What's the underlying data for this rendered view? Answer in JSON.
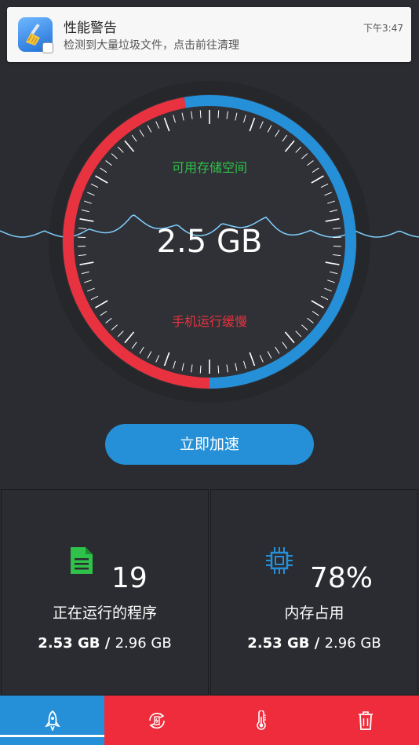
{
  "notification": {
    "title": "性能警告",
    "body": "检测到大量垃圾文件，点击前往清理",
    "time": "下午3:47",
    "icon": "broom-app-icon"
  },
  "gauge": {
    "label_top": "可用存储空间",
    "value": "2.5 GB",
    "label_bottom": "手机运行缓慢",
    "colors": {
      "red": "#e8323f",
      "blue": "#2590d8",
      "green": "#2fc24a"
    }
  },
  "boost_button": {
    "label": "立即加速"
  },
  "stats": {
    "left": {
      "icon": "document-icon",
      "count": "19",
      "label": "正在运行的程序",
      "mem_used": "2.53 GB",
      "mem_sep": " / ",
      "mem_total": "2.96 GB"
    },
    "right": {
      "icon": "cpu-chip-icon",
      "count": "78%",
      "label": "内存占用",
      "mem_used": "2.53 GB",
      "mem_sep": " / ",
      "mem_total": "2.96 GB"
    }
  },
  "bottom_nav": {
    "tabs": [
      {
        "icon": "rocket-icon",
        "active": true
      },
      {
        "icon": "refresh-battery-icon",
        "active": false
      },
      {
        "icon": "thermometer-icon",
        "active": false
      },
      {
        "icon": "trash-icon",
        "active": false
      }
    ]
  }
}
